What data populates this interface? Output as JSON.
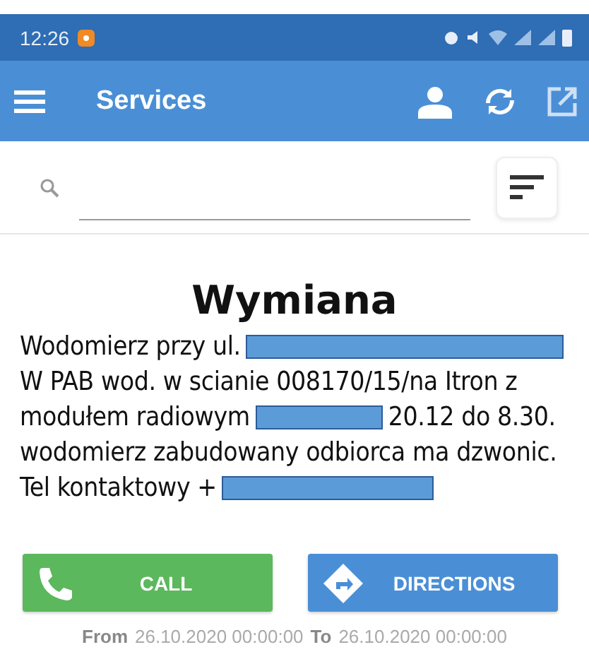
{
  "status_bar": {
    "time": "12:26"
  },
  "app_bar": {
    "title": "Services"
  },
  "order": {
    "title": "Wymiana",
    "lines": [
      [
        {
          "kind": "text",
          "text": "Wodomierz przy ul."
        },
        {
          "kind": "redacted"
        }
      ],
      [
        {
          "kind": "text",
          "text": "W PAB wod. w scianie 008170/15/na Itron z"
        }
      ],
      [
        {
          "kind": "text",
          "text": "modułem radiowym"
        },
        {
          "kind": "redacted"
        },
        {
          "kind": "text",
          "text": "20.12 do 8.30."
        }
      ],
      [
        {
          "kind": "text",
          "text": "wodomierz zabudowany odbiorca ma dzwonic."
        }
      ],
      [
        {
          "kind": "text",
          "text": "Tel kontaktowy +"
        },
        {
          "kind": "redacted"
        }
      ]
    ]
  },
  "buttons": [
    {
      "kind": "call",
      "label": "CALL"
    },
    {
      "kind": "directions",
      "label": "DIRECTIONS"
    }
  ],
  "schedule": {
    "from_label": "From",
    "from": "26.10.2020 00:00:00",
    "to_label": "To",
    "to": "26.10.2020 00:00:00"
  }
}
